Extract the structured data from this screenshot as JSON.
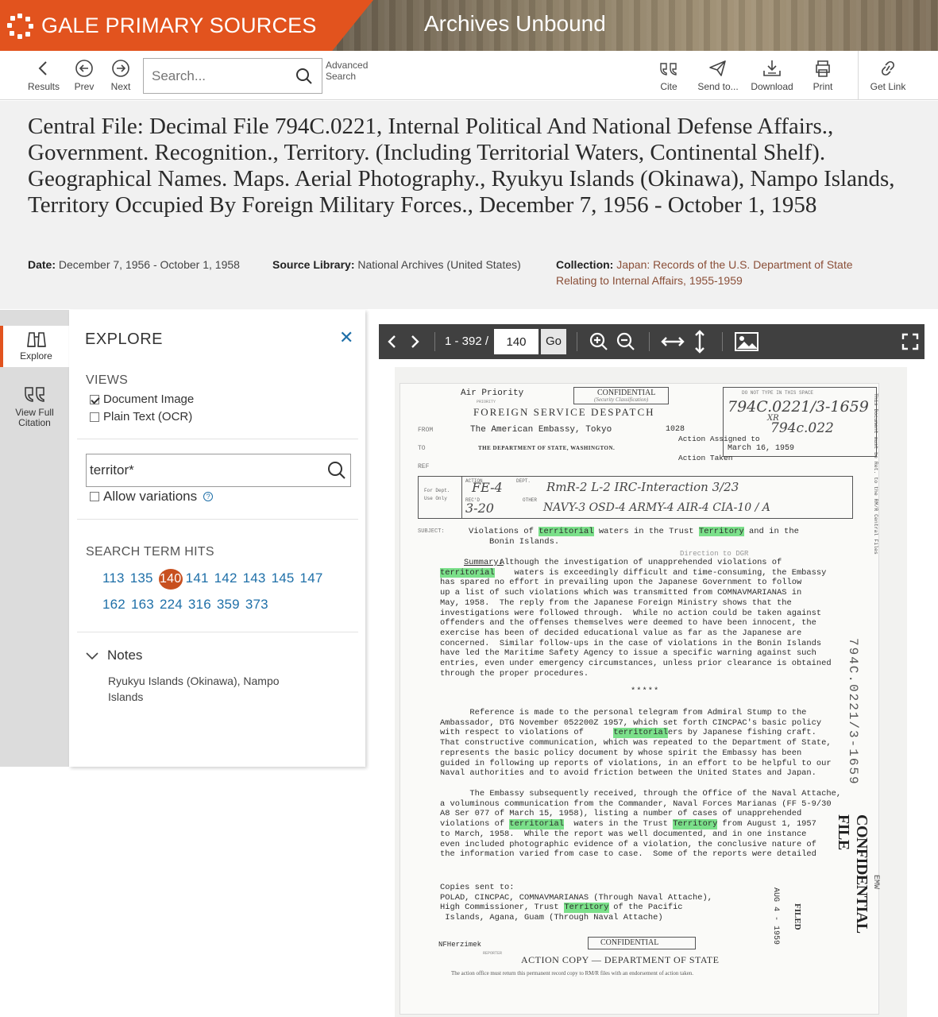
{
  "banner": {
    "brand": "GALE PRIMARY SOURCES",
    "product": "Archives Unbound",
    "brand_color": "#e2531e"
  },
  "toolbar": {
    "results": "Results",
    "prev": "Prev",
    "next": "Next",
    "search_placeholder": "Search...",
    "advanced_search_line1": "Advanced",
    "advanced_search_line2": "Search",
    "cite": "Cite",
    "send_to": "Send to...",
    "download": "Download",
    "print": "Print",
    "get_link": "Get Link"
  },
  "document": {
    "title": "Central File: Decimal File 794C.0221, Internal Political And National Defense Affairs., Government. Recognition., Territory. (Including Territorial Waters, Continental Shelf). Geographical Names. Maps. Aerial Photography., Ryukyu Islands (Okinawa), Nampo Islands, Territory Occupied By Foreign Military Forces., December 7, 1956 - October 1, 1958",
    "date_label": "Date:",
    "date_value": "December 7, 1956 - October 1, 1958",
    "source_label": "Source Library:",
    "source_value": "National Archives (United States)",
    "collection_label": "Collection:",
    "collection_value_line1": "Japan: Records of the U.S. Department of State",
    "collection_value_line2": "Relating to Internal Affairs, 1955-1959"
  },
  "rail": {
    "explore": "Explore",
    "view_full_line1": "View Full",
    "view_full_line2": "Citation"
  },
  "explore": {
    "title": "EXPLORE",
    "views_label": "VIEWS",
    "view_document_image": "Document Image",
    "view_plain_text": "Plain Text (OCR)",
    "document_image_checked": true,
    "plain_text_checked": false,
    "search_value": "territor*",
    "allow_variations": "Allow variations",
    "hits_label": "SEARCH TERM HITS",
    "hits_row1": [
      "113",
      "135",
      "140",
      "141",
      "142",
      "143",
      "145",
      "147"
    ],
    "hits_row2": [
      "162",
      "163",
      "224",
      "316",
      "359",
      "373"
    ],
    "current_hit": "140",
    "notes_label": "Notes",
    "notes_text": "Ryukyu Islands (Okinawa), Nampo Islands"
  },
  "viewer": {
    "page_range": "1 - 392 /",
    "page_value": "140",
    "go": "Go"
  },
  "scan": {
    "air_priority": "Air Priority",
    "priority_label": "PRIORITY",
    "classification": "CONFIDENTIAL",
    "security_class": "(Security Classification)",
    "despatch": "FOREIGN SERVICE DESPATCH",
    "do_not_type": "DO NOT TYPE IN THIS SPACE",
    "file_no_hand": "794C.0221/3-1659",
    "xr_hand": "XR",
    "file_no_hand2": "794c.022",
    "from_label": "FROM",
    "from_value": "The American Embassy, Tokyo",
    "to_label": "TO",
    "to_value": "THE DEPARTMENT OF STATE, WASHINGTON.",
    "ref_label": "REF",
    "desp_no": "1028",
    "action_assigned": "Action Assigned to",
    "date_sent": "March 16, 1959",
    "action_taken": "Action Taken",
    "action_label": "ACTION",
    "dept_label": "DEPT.",
    "recd_label": "REC'D",
    "other_label": "OTHER",
    "for_dept": "For Dept. Use Only",
    "box_hand1": "FE-4",
    "box_hand2": "RmR-2  L-2  IRC-Interaction 3/23",
    "box_hand3": "3-20",
    "box_hand4": "NAVY-3  OSD-4  ARMY-4  AIR-4  CIA-10 / A",
    "subject_label": "SUBJECT:",
    "subject_1": "Violations of",
    "subject_hl1": "territorial",
    "subject_2": "waters in the Trust",
    "subject_hl2": "Territory",
    "subject_3": "and in the",
    "subject_4": "Bonin Islands.",
    "direction": "Direction to DGR",
    "summary_label": "Summary:",
    "para1": [
      "            Although the investigation of unapprehended violations of",
      "               waters is exceedingly difficult and time-consuming, the Embassy",
      "has spared no effort in prevailing upon the Japanese Government to follow",
      "up a list of such violations which was transmitted from COMNAVMARIANAS in",
      "May, 1958.  The reply from the Japanese Foreign Ministry shows that the",
      "investigations were followed through.  While no action could be taken against",
      "offenders and the offenses themselves were deemed to have been innocent, the",
      "exercise has been of decided educational value as far as the Japanese are",
      "concerned.  Similar follow-ups in the case of violations in the Bonin Islands",
      "have led the Maritime Safety Agency to issue a specific warning against such",
      "entries, even under emergency circumstances, unless prior clearance is obtained",
      "through the proper procedures."
    ],
    "stars": "*****",
    "para2": [
      "      Reference is made to the personal telegram from Admiral Stump to the",
      "Ambassador, DTG November 052200Z 1957, which set forth CINCPAC's basic policy",
      "with respect to violations of              waters by Japanese fishing craft.",
      "That constructive communication, which was repeated to the Department of State,",
      "represents the basic policy document by whose spirit the Embassy has been",
      "guided in following up reports of violations, in an effort to be helpful to our",
      "Naval authorities and to avoid friction between the United States and Japan."
    ],
    "para3": [
      "      The Embassy subsequently received, through the Office of the Naval Attache,",
      "a voluminous communication from the Commander, Naval Forces Marianas (FF 5-9/30",
      "A8 Ser 077 of March 15, 1958), listing a number of cases of unapprehended",
      "violations of              waters in the Trust           from August 1, 1957",
      "to March, 1958.  While the report was well documented, and in one instance",
      "even included photographic evidence of a violation, the conclusive nature of",
      "the information varied from case to case.  Some of the reports were detailed"
    ],
    "hl_territorial": "territorial",
    "hl_territory": "Territory",
    "copies": [
      "Copies sent to:",
      "POLAD, CINCPAC, COMNAVMARIANAS (Through Naval Attache),",
      "High Commissioner, Trust           of the Pacific",
      " Islands, Agana, Guam (Through Naval Attache)"
    ],
    "drafter": "NFHerzimek",
    "reporter": "REPORTER",
    "footer_class": "CONFIDENTIAL",
    "action_copy": "ACTION COPY — DEPARTMENT OF STATE",
    "footer_note": "The action office must return this permanent record copy to RM/R files with an endorsement of action taken.",
    "side_stamp": "794C.0221/3-1659",
    "side_conf": "CONFIDENTIAL FILE",
    "side_note": "This Document must be Ret. to the RM/R Central Files",
    "filed": "FILED",
    "aug": "AUG 4 - 1959",
    "emw": "EMW"
  }
}
